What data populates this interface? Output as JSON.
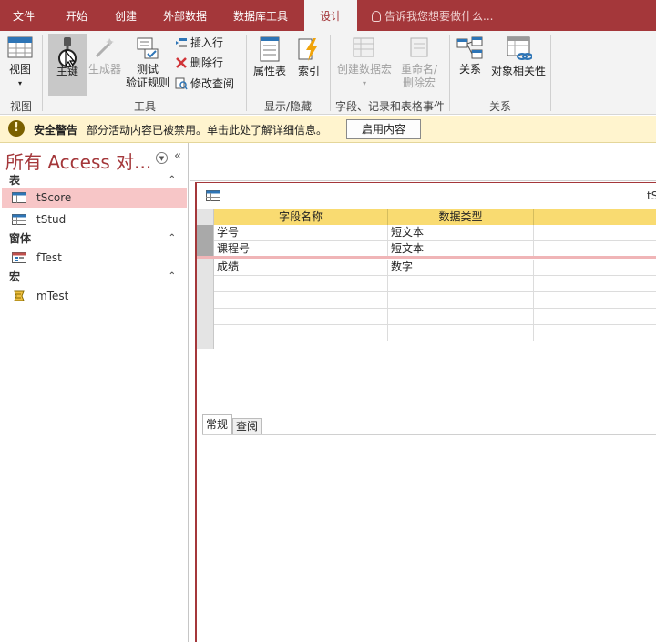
{
  "tabs": [
    {
      "label": "文件",
      "active": false
    },
    {
      "label": "开始",
      "active": false
    },
    {
      "label": "创建",
      "active": false
    },
    {
      "label": "外部数据",
      "active": false
    },
    {
      "label": "数据库工具",
      "active": false
    },
    {
      "label": "设计",
      "active": true
    }
  ],
  "tell_me": "告诉我您想要做什么...",
  "ribbon": {
    "view": {
      "label": "视图"
    },
    "primary_key": {
      "label": "主键"
    },
    "builder": {
      "label": "生成器"
    },
    "test_rules": {
      "label1": "测试",
      "label2": "验证规则"
    },
    "insert_row": "插入行",
    "delete_row": "删除行",
    "modify_lookups": "修改查阅",
    "property_sheet": "属性表",
    "indexes": "索引",
    "create_data_macro": {
      "label1": "创建数据宏",
      "label2": "▾"
    },
    "rename_macro": {
      "label1": "重命名/",
      "label2": "删除宏"
    },
    "relationships": "关系",
    "dependencies": "对象相关性",
    "groups": {
      "view": "视图",
      "tools": "工具",
      "show_hide": "显示/隐藏",
      "field_events": "字段、记录和表格事件",
      "relationships": "关系"
    }
  },
  "security": {
    "title": "安全警告",
    "message": "部分活动内容已被禁用。单击此处了解详细信息。",
    "button": "启用内容"
  },
  "nav": {
    "title": "所有 Access 对...",
    "sections": [
      {
        "label": "表",
        "items": [
          {
            "label": "tScore",
            "selected": true
          },
          {
            "label": "tStud",
            "selected": false
          }
        ]
      },
      {
        "label": "窗体",
        "items": [
          {
            "label": "fTest",
            "selected": false
          }
        ]
      },
      {
        "label": "宏",
        "items": [
          {
            "label": "mTest",
            "selected": false
          }
        ]
      }
    ]
  },
  "document": {
    "tab_name": "tS",
    "columns": [
      "字段名称",
      "数据类型"
    ],
    "rows": [
      {
        "field": "学号",
        "type": "短文本",
        "key": true
      },
      {
        "field": "课程号",
        "type": "短文本",
        "key": true
      },
      {
        "field": "成绩",
        "type": "数字",
        "key": false
      }
    ],
    "property_tabs": [
      "常规",
      "查阅"
    ]
  },
  "colors": {
    "accent": "#a4373a",
    "header": "#f9db71",
    "selected": "#f7c6c7"
  }
}
